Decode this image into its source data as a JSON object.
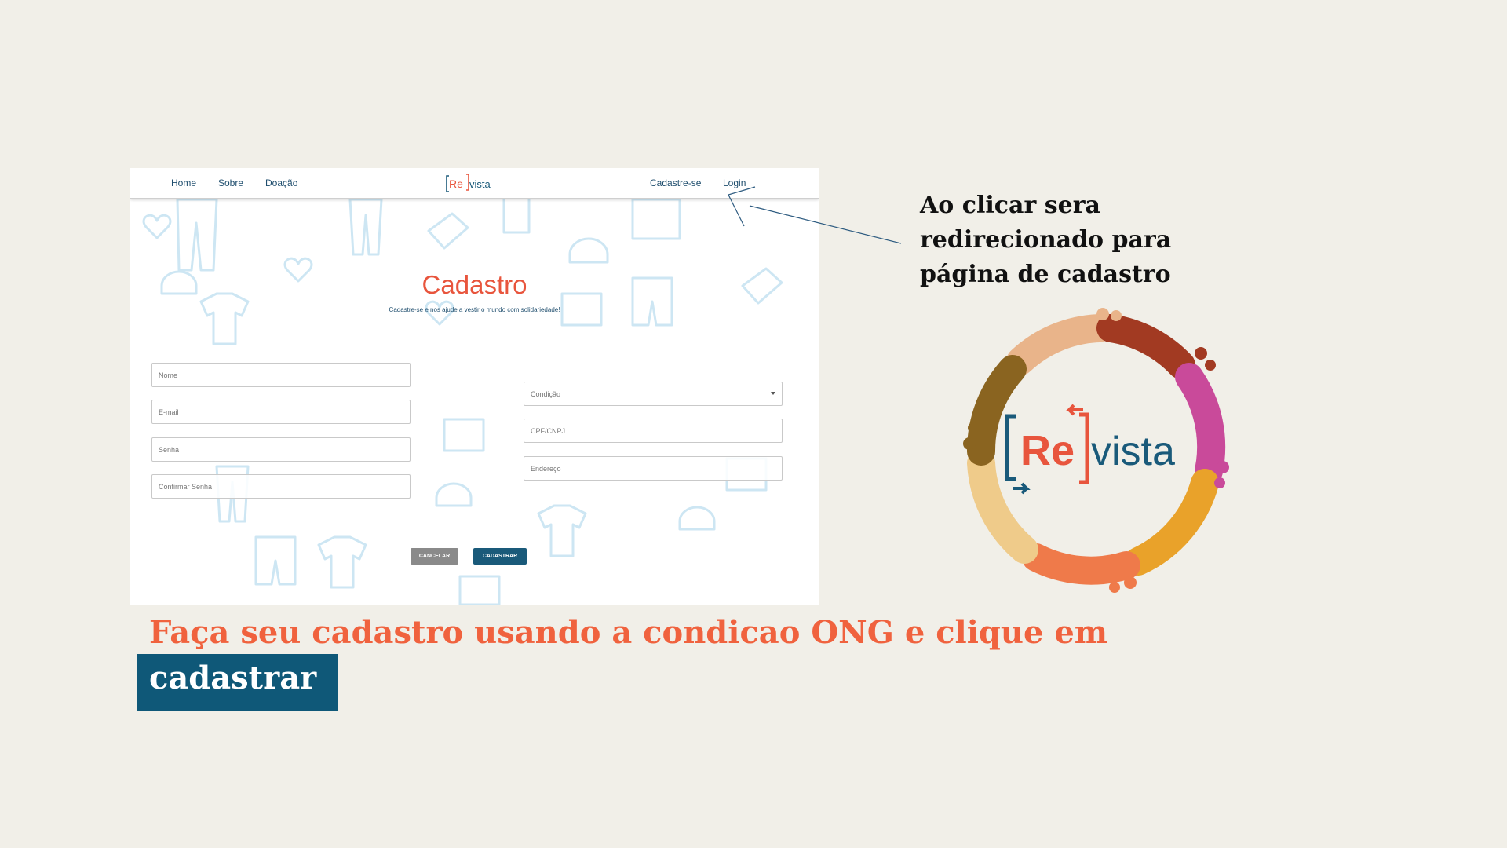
{
  "screenshot": {
    "nav": {
      "home": "Home",
      "about": "Sobre",
      "donation": "Doação",
      "signup": "Cadastre-se",
      "login": "Login"
    },
    "logo": {
      "re": "Re",
      "vista": "vista"
    },
    "form": {
      "title": "Cadastro",
      "subtitle": "Cadastre-se e nos ajude a vestir o mundo com solidariedade!",
      "name_placeholder": "Nome",
      "email_placeholder": "E-mail",
      "password_placeholder": "Senha",
      "confirm_password_placeholder": "Confirmar Senha",
      "condition_placeholder": "Condição",
      "cpf_placeholder": "CPF/CNPJ",
      "address_placeholder": "Endereço",
      "cancel_label": "CANCELAR",
      "submit_label": "CADASTRAR"
    }
  },
  "annotation": {
    "text": "Ao clicar sera redirecionado para página de cadastro"
  },
  "emblem": {
    "re": "Re",
    "vista": "vista"
  },
  "caption": {
    "line1": "Faça seu cadastro usando a condicao ONG e clique em",
    "line2": "cadastrar"
  },
  "colors": {
    "background": "#f1efe8",
    "brand_orange": "#e8553d",
    "brand_blue": "#1a5a7a",
    "caption_orange": "#f0623e",
    "caption_box": "#0f5878",
    "hand_colors": [
      "#e9b48a",
      "#a23a22",
      "#c94a9a",
      "#e9a22a",
      "#ef7a4a",
      "#efcb8a",
      "#8a6420"
    ]
  }
}
